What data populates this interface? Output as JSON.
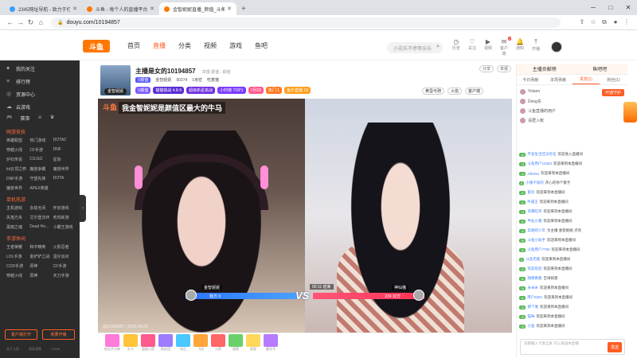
{
  "browser": {
    "tabs": [
      {
        "title": "2345网址导航 - 致力于打造百",
        "color": "#3aa0ff",
        "active": false
      },
      {
        "title": "斗鱼 - 每个人的直播平台",
        "color": "#ff7700",
        "active": false
      },
      {
        "title": "金智妮妮直播_颜值_斗鱼",
        "color": "#ff7700",
        "active": true
      }
    ],
    "url": "douyu.com/10194857",
    "newtab": "+"
  },
  "header": {
    "logo": "斗鱼",
    "nav": [
      "首页",
      "直播",
      "分类",
      "视频",
      "游戏",
      "鱼吧"
    ],
    "nav_active": "直播",
    "search_placeholder": "小花乐不停哥乐乐",
    "icons": [
      {
        "name": "history-icon",
        "label": "历史"
      },
      {
        "name": "follow-icon",
        "label": "关注"
      },
      {
        "name": "video-icon",
        "label": "视频"
      },
      {
        "name": "message-icon",
        "label": "客户端"
      },
      {
        "name": "notification-icon",
        "label": "通知"
      },
      {
        "name": "upload-icon",
        "label": "开播"
      }
    ],
    "message_badge": "3"
  },
  "sidebar": {
    "items": [
      {
        "icon": "heart-icon",
        "label": "我的关注"
      },
      {
        "icon": "rank-icon",
        "label": "排行榜"
      },
      {
        "icon": "resource-icon",
        "label": "资源中心"
      },
      {
        "icon": "cloud-icon",
        "label": "云游戏"
      }
    ],
    "sec1": "网游竞技",
    "sec1_items": [
      "英雄联盟",
      "热门游戏",
      "DOTA2",
      "穿越火线",
      "CF手游",
      "DNF",
      "炉石传说",
      "CS:GO",
      "星际",
      "lol云顶之弈",
      "魔兽争霸",
      "魔兽世界",
      "DNF手游",
      "守望先锋",
      "DOTA",
      "魔兽世界",
      "APEX英雄",
      ""
    ],
    "sec2": "单机热游",
    "sec2_items": [
      "主机游戏",
      "永劫无间",
      "怀旧游戏",
      "失落方舟",
      "艾尔登法环",
      "吃鸡新游",
      "黑暗之魂",
      "Dead Ho...",
      "小霸王游戏"
    ],
    "sec3": "手游休闲",
    "sec3_items": [
      "王者荣耀",
      "和平精英",
      "火影忍者",
      "LOL手游",
      "金铲铲之战",
      "蛋仔派对",
      "COD手游",
      "原神",
      "CF手游",
      "穿越火线",
      "原神",
      "天刀手游"
    ],
    "games_label": "赛事",
    "btn_client": "客户端打开",
    "btn_live": "我要开播",
    "footer": [
      "关于斗鱼",
      "隐私政策",
      "12345"
    ]
  },
  "room": {
    "title": "主播是女的10194857",
    "sub": "举报  颜值 - 颜值",
    "tag": "V颜值",
    "name": "金智妮妮",
    "heat": "90374",
    "rank": "1亲密",
    "fans": "吃着猫",
    "tags": [
      {
        "text": "V颜值",
        "color": "#7b5cff"
      },
      {
        "text": "猫猫挑战 4.8-5",
        "color": "#5b2bd6"
      },
      {
        "text": "超级新星挑战",
        "color": "#6d2ce0"
      },
      {
        "text": "小时榜 TOP1",
        "color": "#7a3cff"
      },
      {
        "text": "7月28",
        "color": "#ff5a8c"
      },
      {
        "text": "热门 1",
        "color": "#ff7a22"
      },
      {
        "text": "鱼乐直播 19",
        "color": "#ff9f1c"
      }
    ],
    "actions": [
      "分享",
      "举报"
    ],
    "actions2": [
      "黄昏弓骑",
      "火焰",
      "客户端"
    ],
    "avatar_level": "金智妮妮"
  },
  "video": {
    "logo": "斗鱼",
    "caption": "我金智妮妮是颜值区最大的牛马",
    "left_name": "金智妮妮",
    "right_name": "神仙猫",
    "left_score": "我方 0",
    "right_score": "234 对方",
    "timer": "00:11 结束",
    "vs": "VS",
    "rec": "@10194857 | 2022.04.02",
    "badge": "夜景秀鸭"
  },
  "giftbar": {
    "labels": [
      "粉丝荧光棒",
      "办卡",
      "超级火箭",
      "粉丝团",
      "钻石",
      "飞机",
      "火箭",
      "超跑",
      "星星",
      "嘉年华"
    ]
  },
  "right": {
    "head": [
      "主播贡献榜",
      "鱼吧吧"
    ],
    "tabs": [
      "今日贡献",
      "本周贡献",
      "贵宾(1)",
      "粉丝(1)"
    ],
    "open_guard": "开通守护",
    "ranks": [
      "Yoluen",
      "Dong东",
      "斗鱼直播的用户",
      "请君入帐"
    ],
    "messages": [
      {
        "lv": "12",
        "name": "不会生活还没有名",
        "text": "欢迎进入直播间"
      },
      {
        "lv": "14",
        "name": "斗鱼用户10453",
        "text": "欢迎来到本直播间"
      },
      {
        "lv": "13",
        "name": "Allh4ku",
        "text": "欢迎来到本直播间"
      },
      {
        "lv": "8",
        "name": "小猪干饭的",
        "text": "开心的你个傻子"
      },
      {
        "lv": "10",
        "name": "紫云",
        "text": "欢迎来到本直播间"
      },
      {
        "lv": "11",
        "name": "牛逼王",
        "text": "欢迎来到本直播间"
      },
      {
        "lv": "14",
        "name": "老鹰吃鸡",
        "text": "欢迎来到本直播间"
      },
      {
        "lv": "10",
        "name": "半仙小猪",
        "text": "欢迎来到本直播间"
      },
      {
        "lv": "12",
        "name": "奔跑吧少年",
        "text": "为主播 金智妮妮 点亮"
      },
      {
        "lv": "15",
        "name": "斗鱼小助手",
        "text": "欢迎来到本直播间"
      },
      {
        "lv": "12",
        "name": "斗鱼用户7780",
        "text": "欢迎来到本直播间"
      },
      {
        "lv": "9",
        "name": "斗鱼无敌",
        "text": "欢迎来到本直播间"
      },
      {
        "lv": "13",
        "name": "欢迎欢迎",
        "text": "欢迎来到本直播间"
      },
      {
        "lv": "10",
        "name": "随便看看",
        "text": "吉祥如意"
      },
      {
        "lv": "14",
        "name": "米米米",
        "text": "欢迎来到本直播间"
      },
      {
        "lv": "11",
        "name": "用户6281",
        "text": "欢迎来到本直播间"
      },
      {
        "lv": "12",
        "name": "那个谁",
        "text": "欢迎来到本直播间"
      },
      {
        "lv": "13",
        "name": "猫咪",
        "text": "欢迎来到本直播间"
      },
      {
        "lv": "10",
        "name": "小鱼",
        "text": "欢迎来到本直播间"
      }
    ],
    "input_placeholder": "说都输入卡发全屏  可以发送本直播",
    "send": "发送"
  }
}
